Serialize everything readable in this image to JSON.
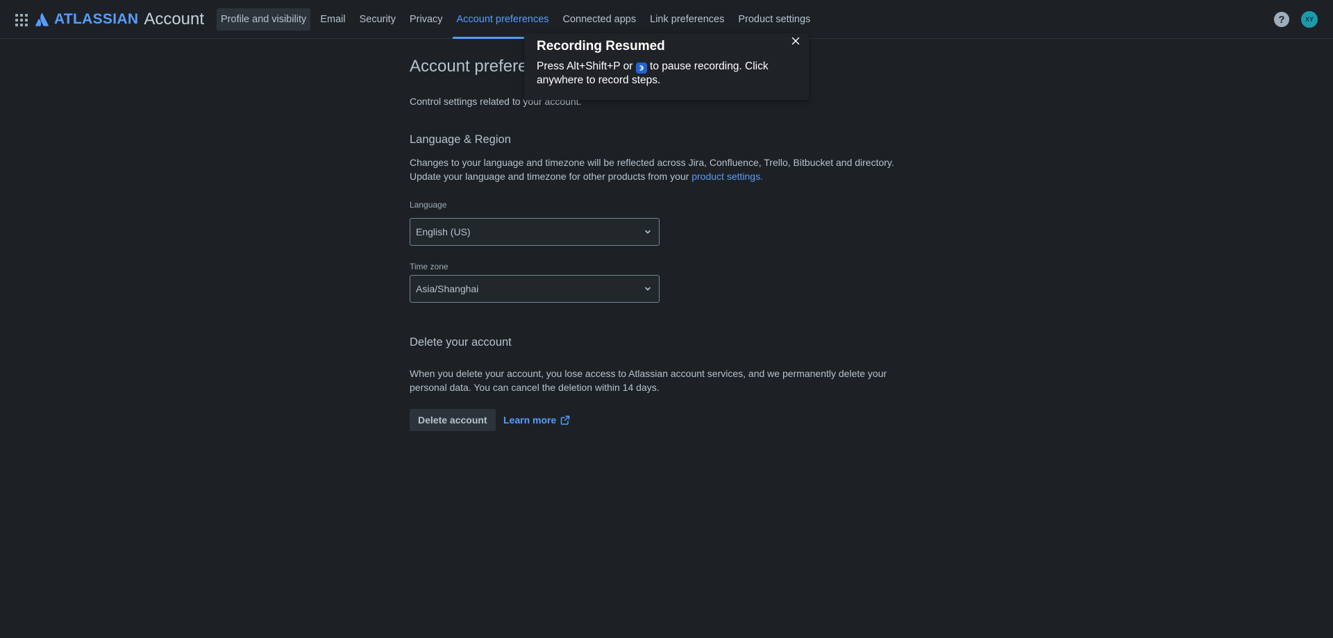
{
  "header": {
    "brand_name": "ATLASSIAN",
    "brand_product": "Account",
    "tabs": [
      {
        "label": "Profile and visibility"
      },
      {
        "label": "Email"
      },
      {
        "label": "Security"
      },
      {
        "label": "Privacy"
      },
      {
        "label": "Account preferences"
      },
      {
        "label": "Connected apps"
      },
      {
        "label": "Link preferences"
      },
      {
        "label": "Product settings"
      }
    ],
    "active_tab": "Account preferences",
    "help_label": "?",
    "avatar_initials": "XY",
    "icons": {
      "app_switcher": "app-switcher-icon",
      "logo": "atlassian-logo-icon",
      "help": "help-icon"
    }
  },
  "main": {
    "title": "Account preferences",
    "description": "Control settings related to your account.",
    "language_region": {
      "title": "Language & Region",
      "text_before_link": "Changes to your language and timezone will be reflected across Jira, Confluence, Trello, Bitbucket and directory. Update your language and timezone for other products from your ",
      "link_text": "product settings.",
      "language_label": "Language",
      "language_value": "English (US)",
      "timezone_label": "Time zone",
      "timezone_value": "Asia/Shanghai"
    },
    "delete_account": {
      "title": "Delete your account",
      "text": "When you delete your account, you lose access to Atlassian account services, and we permanently delete your personal data. You can cancel the deletion within 14 days.",
      "delete_button": "Delete account",
      "learn_more": "Learn more"
    }
  },
  "toast": {
    "title": "Recording Resumed",
    "body_before_icon": "Press Alt+Shift+P or ",
    "body_after_icon": " to pause recording. Click anywhere to record steps."
  },
  "colors": {
    "background": "#1d2125",
    "accent": "#579dff",
    "text": "#b6c2cf",
    "avatar": "#1d9aaa"
  }
}
